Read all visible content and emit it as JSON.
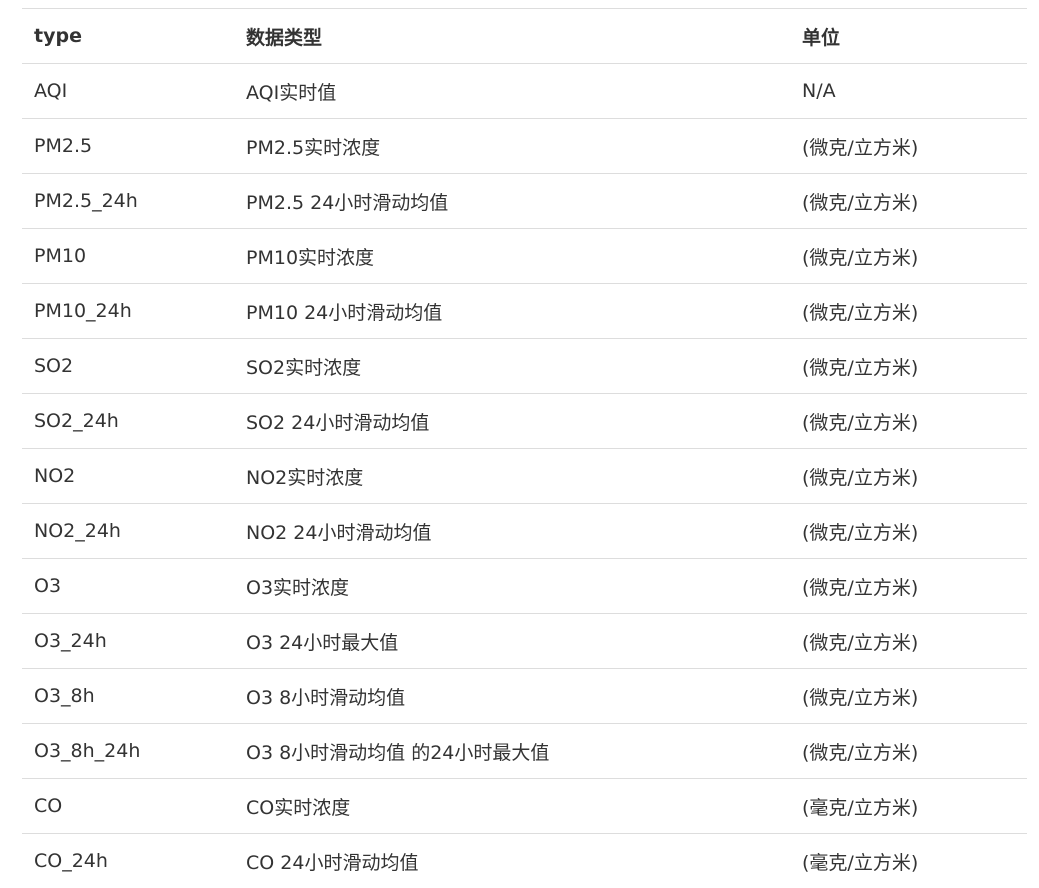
{
  "table": {
    "headers": [
      "type",
      "数据类型",
      "单位"
    ],
    "rows": [
      [
        "AQI",
        "AQI实时值",
        "N/A"
      ],
      [
        "PM2.5",
        "PM2.5实时浓度",
        "(微克/立方米)"
      ],
      [
        "PM2.5_24h",
        "PM2.5 24小时滑动均值",
        "(微克/立方米)"
      ],
      [
        "PM10",
        "PM10实时浓度",
        "(微克/立方米)"
      ],
      [
        "PM10_24h",
        "PM10 24小时滑动均值",
        "(微克/立方米)"
      ],
      [
        "SO2",
        "SO2实时浓度",
        "(微克/立方米)"
      ],
      [
        "SO2_24h",
        "SO2 24小时滑动均值",
        "(微克/立方米)"
      ],
      [
        "NO2",
        "NO2实时浓度",
        "(微克/立方米)"
      ],
      [
        "NO2_24h",
        "NO2 24小时滑动均值",
        "(微克/立方米)"
      ],
      [
        "O3",
        "O3实时浓度",
        "(微克/立方米)"
      ],
      [
        "O3_24h",
        "O3 24小时最大值",
        "(微克/立方米)"
      ],
      [
        "O3_8h",
        "O3 8小时滑动均值",
        "(微克/立方米)"
      ],
      [
        "O3_8h_24h",
        "O3 8小时滑动均值 的24小时最大值",
        "(微克/立方米)"
      ],
      [
        "CO",
        "CO实时浓度",
        "(毫克/立方米)"
      ],
      [
        "CO_24h",
        "CO 24小时滑动均值",
        "(毫克/立方米)"
      ]
    ]
  }
}
